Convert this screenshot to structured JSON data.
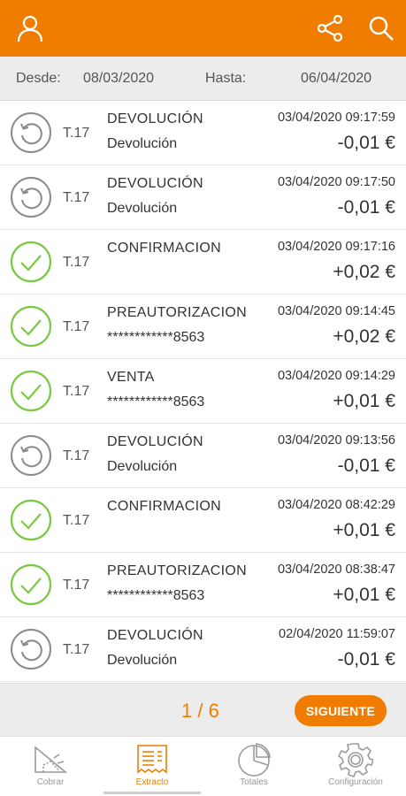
{
  "colors": {
    "accent": "#f07c00",
    "confirm": "#7ac943",
    "neutral": "#8a8a8a"
  },
  "header": {
    "user_icon": "user-icon",
    "share_icon": "share-icon",
    "search_icon": "search-icon"
  },
  "range": {
    "from_label": "Desde:",
    "from_value": "08/03/2020",
    "to_label": "Hasta:",
    "to_value": "06/04/2020"
  },
  "transactions": [
    {
      "status": "reversed",
      "terminal": "T.17",
      "type": "DEVOLUCIÓN",
      "desc": "Devolución",
      "date": "03/04/2020 09:17:59",
      "amount": "-0,01 €"
    },
    {
      "status": "reversed",
      "terminal": "T.17",
      "type": "DEVOLUCIÓN",
      "desc": "Devolución",
      "date": "03/04/2020 09:17:50",
      "amount": "-0,01 €"
    },
    {
      "status": "ok",
      "terminal": "T.17",
      "type": "CONFIRMACION",
      "desc": "",
      "date": "03/04/2020 09:17:16",
      "amount": "+0,02 €"
    },
    {
      "status": "ok",
      "terminal": "T.17",
      "type": "PREAUTORIZACION",
      "desc": "************8563",
      "date": "03/04/2020 09:14:45",
      "amount": "+0,02 €"
    },
    {
      "status": "ok",
      "terminal": "T.17",
      "type": "VENTA",
      "desc": "************8563",
      "date": "03/04/2020 09:14:29",
      "amount": "+0,01 €"
    },
    {
      "status": "reversed",
      "terminal": "T.17",
      "type": "DEVOLUCIÓN",
      "desc": "Devolución",
      "date": "03/04/2020 09:13:56",
      "amount": "-0,01 €"
    },
    {
      "status": "ok",
      "terminal": "T.17",
      "type": "CONFIRMACION",
      "desc": "",
      "date": "03/04/2020 08:42:29",
      "amount": "+0,01 €"
    },
    {
      "status": "ok",
      "terminal": "T.17",
      "type": "PREAUTORIZACION",
      "desc": "************8563",
      "date": "03/04/2020 08:38:47",
      "amount": "+0,01 €"
    },
    {
      "status": "reversed",
      "terminal": "T.17",
      "type": "DEVOLUCIÓN",
      "desc": "Devolución",
      "date": "02/04/2020 11:59:07",
      "amount": "-0,01 €"
    }
  ],
  "pager": {
    "page": "1 / 6",
    "next_label": "SIGUIENTE"
  },
  "tabs": [
    {
      "label": "Cobrar",
      "icon": "charge-icon"
    },
    {
      "label": "Extracto",
      "icon": "receipt-icon",
      "active": true
    },
    {
      "label": "Totales",
      "icon": "pie-chart-icon"
    },
    {
      "label": "Configuración",
      "icon": "gear-icon"
    }
  ]
}
